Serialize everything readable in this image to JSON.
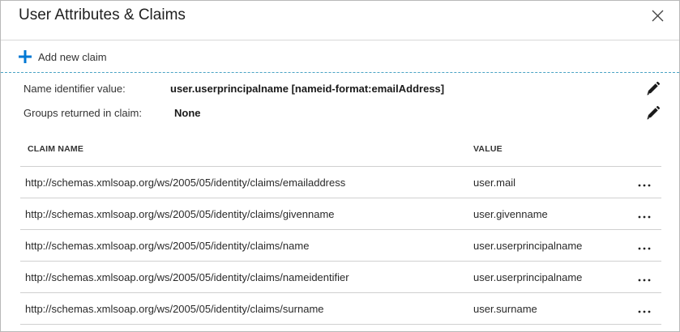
{
  "header": {
    "title": "User Attributes & Claims",
    "close_icon": "close-icon"
  },
  "toolbar": {
    "add_label": "Add new claim",
    "add_icon": "plus-icon",
    "accent_color": "#0078d4"
  },
  "name_identifier": {
    "label": "Name identifier value:",
    "value": "user.userprincipalname [nameid-format:emailAddress]",
    "edit_icon": "pencil-icon"
  },
  "groups": {
    "label": "Groups returned in claim:",
    "value": "None",
    "edit_icon": "pencil-icon"
  },
  "table": {
    "columns": {
      "claim_name": "CLAIM NAME",
      "value": "VALUE"
    },
    "rows": [
      {
        "name": "http://schemas.xmlsoap.org/ws/2005/05/identity/claims/emailaddress",
        "value": "user.mail",
        "more": "..."
      },
      {
        "name": "http://schemas.xmlsoap.org/ws/2005/05/identity/claims/givenname",
        "value": "user.givenname",
        "more": "..."
      },
      {
        "name": "http://schemas.xmlsoap.org/ws/2005/05/identity/claims/name",
        "value": "user.userprincipalname",
        "more": "..."
      },
      {
        "name": "http://schemas.xmlsoap.org/ws/2005/05/identity/claims/nameidentifier",
        "value": "user.userprincipalname",
        "more": "..."
      },
      {
        "name": "http://schemas.xmlsoap.org/ws/2005/05/identity/claims/surname",
        "value": "user.surname",
        "more": "..."
      }
    ]
  }
}
